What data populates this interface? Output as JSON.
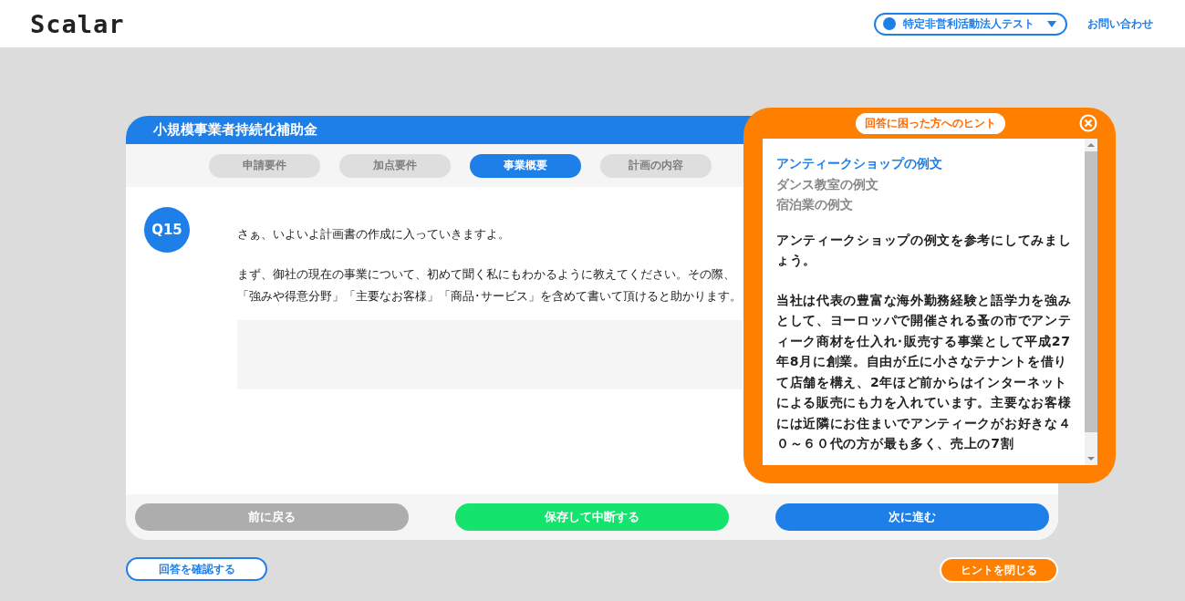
{
  "header": {
    "logo": "Scalar",
    "account": {
      "label": "特定非営利活動法人テスト"
    },
    "contact_link": "お問い合わせ"
  },
  "card": {
    "title": "小規模事業者持続化補助金",
    "tabs": [
      {
        "label": "申請要件",
        "selected": false
      },
      {
        "label": "加点要件",
        "selected": false
      },
      {
        "label": "事業概要",
        "selected": true
      },
      {
        "label": "計画の内容",
        "selected": false
      }
    ],
    "question": {
      "number": "Q15",
      "lines": [
        "さぁ、いよいよ計画書の作成に入っていきますよ。",
        "まず、御社の現在の事業について、初めて聞く私にもわかるように教えてください。その際、",
        "「強みや得意分野」「主要なお客様」「商品･サービス」を含めて書いて頂けると助かります。"
      ]
    },
    "buttons": [
      {
        "label": "前に戻る",
        "kind": "back"
      },
      {
        "label": "保存して中断する",
        "kind": "save"
      },
      {
        "label": "次に進む",
        "kind": "next"
      }
    ]
  },
  "confirm_button": "回答を確認する",
  "close_hint_button": "ヒントを閉じる",
  "hint": {
    "title": "回答に困った方へのヒント",
    "examples": [
      {
        "label": "アンティークショップの例文",
        "selected": true
      },
      {
        "label": "ダンス教室の例文",
        "selected": false
      },
      {
        "label": "宿泊業の例文",
        "selected": false
      }
    ],
    "paragraphs": [
      "アンティークショップの例文を参考にしてみましょう。",
      "当社は代表の豊富な海外勤務経験と語学力を強みとして、ヨーロッパで開催される蚤の市でアンティーク商材を仕入れ･販売する事業として平成27年8月に創業。自由が丘に小さなテナントを借りて店舗を構え、2年ほど前からはインターネットによる販売にも力を入れています。主要なお客様には近隣にお住まいでアンティークがお好きな４０～６０代の方が最も多く、売上の7割"
    ]
  }
}
